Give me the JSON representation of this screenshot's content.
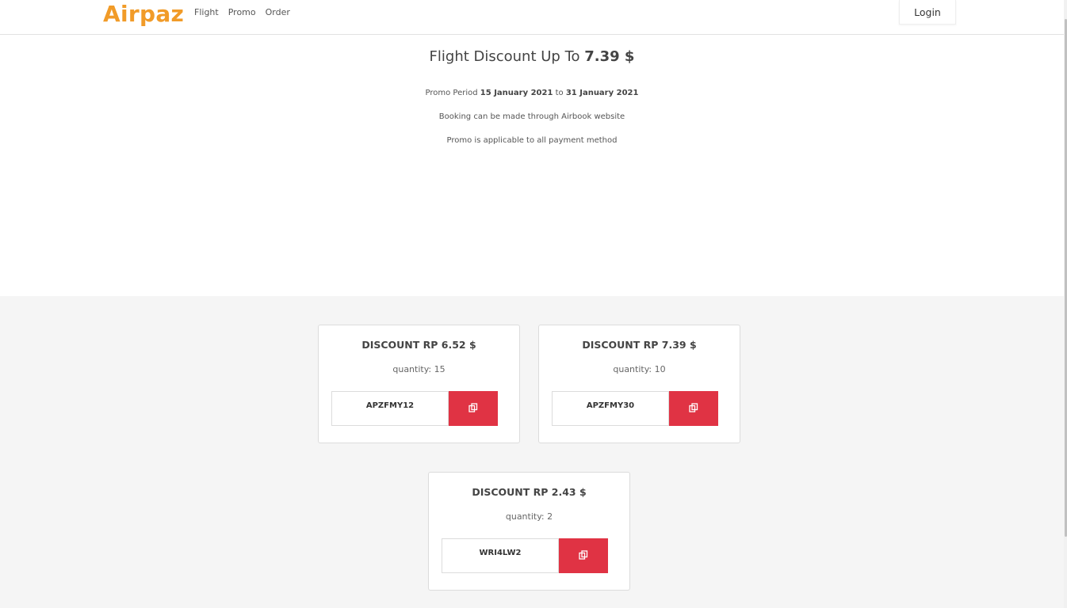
{
  "brand": {
    "name": "Airpaz",
    "color": "#f19b28"
  },
  "nav": {
    "links": [
      "Flight",
      "Promo",
      "Order"
    ],
    "login_label": "Login"
  },
  "hero": {
    "title_prefix": "Flight Discount Up To ",
    "title_amount": "7.39 $",
    "period_label": "Promo Period ",
    "period_start": "15 January 2021",
    "period_to": " to ",
    "period_end": "31 January 2021",
    "line_booking": "Booking can be made through Airbook website",
    "line_payment": "Promo is applicable to all payment method"
  },
  "promos": [
    {
      "title": "DISCOUNT RP 6.52 $",
      "quantity": "quantity: 15",
      "code": "APZFMY12"
    },
    {
      "title": "DISCOUNT RP 7.39 $",
      "quantity": "quantity: 10",
      "code": "APZFMY30"
    },
    {
      "title": "DISCOUNT RP 2.43 $",
      "quantity": "quantity: 2",
      "code": "WRI4LW2"
    }
  ],
  "icons": {
    "copy": "copy-icon"
  },
  "colors": {
    "accent": "#e03344",
    "section_bg": "#f5f5f5"
  }
}
